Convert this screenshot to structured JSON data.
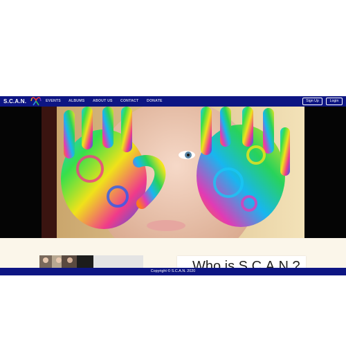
{
  "colors": {
    "nav_background": "#0d1583",
    "page_background": "#ffffff",
    "section_background": "#fbf6ea",
    "nav_link": "#c8cbe6"
  },
  "navbar": {
    "brand": "S.C.A.N.",
    "logo_icon": "puzzle-ribbon-icon",
    "links": [
      "EVENTS",
      "ALBUMS",
      "ABOUT US",
      "CONTACT",
      "DONATE"
    ],
    "signup_label": "Sign Up",
    "login_label": "Login"
  },
  "main": {
    "who_title": "Who is S.C.A.N.?"
  },
  "footer": {
    "copyright": "Copyright © S.C.A.N. 2020"
  }
}
